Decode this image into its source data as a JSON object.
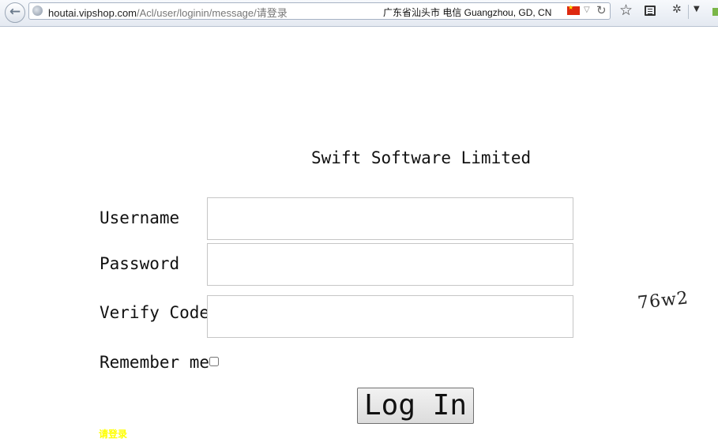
{
  "browser": {
    "url_host": "houtai.vipshop.com",
    "url_path": "/Acl/user/loginin/message/请登录",
    "geo_info": "广东省汕头市 电信   Guangzhou, GD, CN",
    "icons": [
      "back-arrow-icon",
      "site-identity-icon",
      "china-flag-icon",
      "dropdown-arrow-icon",
      "reload-icon",
      "star-icon",
      "reader-icon",
      "addon-icon",
      "menu-arrow-icon"
    ]
  },
  "page": {
    "title": "Swift Software Limited",
    "username_label": "Username",
    "password_label": "Password",
    "verify_label": "Verify Code",
    "remember_label": "Remember me",
    "username_value": "",
    "password_value": "",
    "verify_value": "",
    "remember_checked": false,
    "captcha_text": "76w2",
    "login_button": "Log In",
    "message": "请登录",
    "message_color": "#ffff00"
  }
}
